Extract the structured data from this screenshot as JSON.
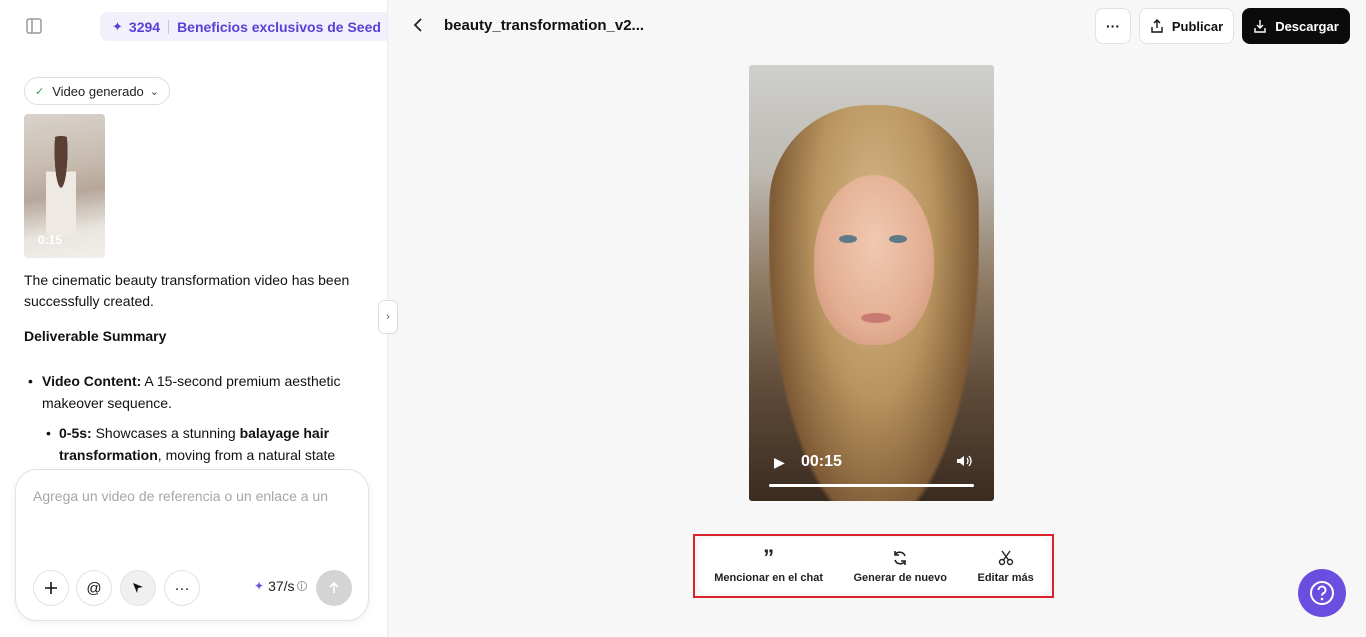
{
  "left_panel": {
    "credits": {
      "amount": "3294",
      "text": "Beneficios exclusivos de Seed"
    },
    "status_pill": "Video generado",
    "thumbnail": {
      "duration": "0:15"
    },
    "message_line1": "The cinematic beauty transformation video has been successfully created.",
    "summary_heading": "Deliverable Summary",
    "bullet1": {
      "label": "Video Content:",
      "text": " A 15-second premium aesthetic makeover sequence."
    },
    "bullet2": {
      "label": "0-5s:",
      "text_a": " Showcases a stunning ",
      "bold_b": "balayage hair transformation",
      "text_c": ", moving from a natural state"
    },
    "composer": {
      "placeholder": "Agrega un video de referencia o un enlace a un",
      "rate": "37/s"
    }
  },
  "right_panel": {
    "title": "beauty_transformation_v2...",
    "buttons": {
      "more": "···",
      "publish": "Publicar",
      "download": "Descargar"
    },
    "video": {
      "time": "00:15",
      "progress": 1.0
    },
    "actions": {
      "mention": "Mencionar en el chat",
      "regenerate": "Generar de nuevo",
      "edit": "Editar más"
    }
  },
  "colors": {
    "accent": "#6a4ee0",
    "highlight": "#d8232a",
    "dark_button": "#0b0b0b"
  }
}
